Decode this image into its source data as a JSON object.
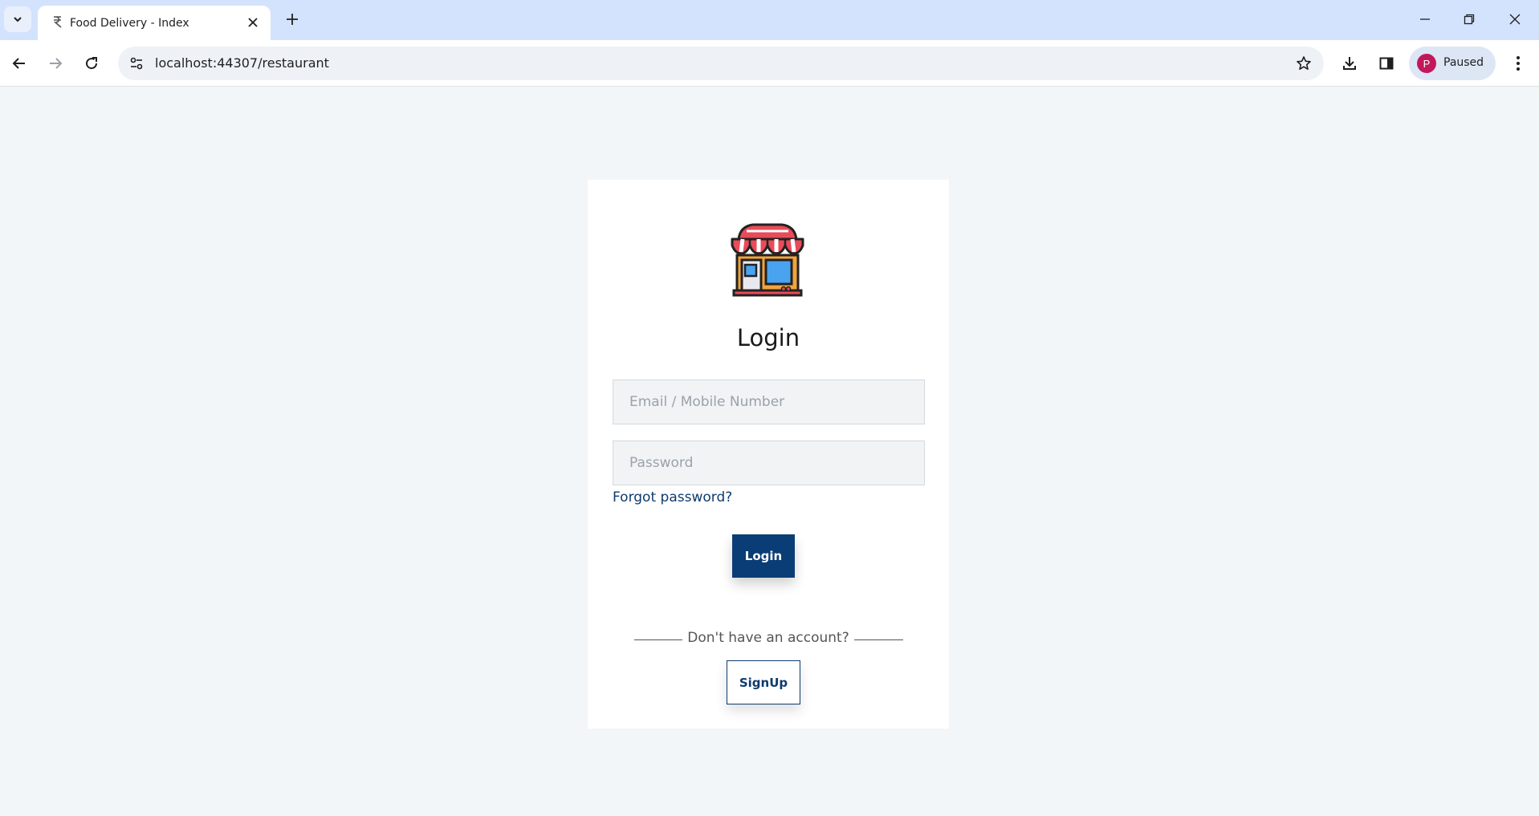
{
  "browser": {
    "tab_title": "Food Delivery - Index",
    "url": "localhost:44307/restaurant",
    "profile_initial": "P",
    "profile_status": "Paused"
  },
  "login": {
    "title": "Login",
    "email_placeholder": "Email / Mobile Number",
    "password_placeholder": "Password",
    "forgot_password": "Forgot password?",
    "login_button": "Login",
    "no_account_text": "Don't have an account?",
    "signup_button": "SignUp"
  },
  "colors": {
    "primary": "#0a3d75",
    "page_background": "#f3f6f8",
    "tabstrip": "#d3e3fd"
  }
}
